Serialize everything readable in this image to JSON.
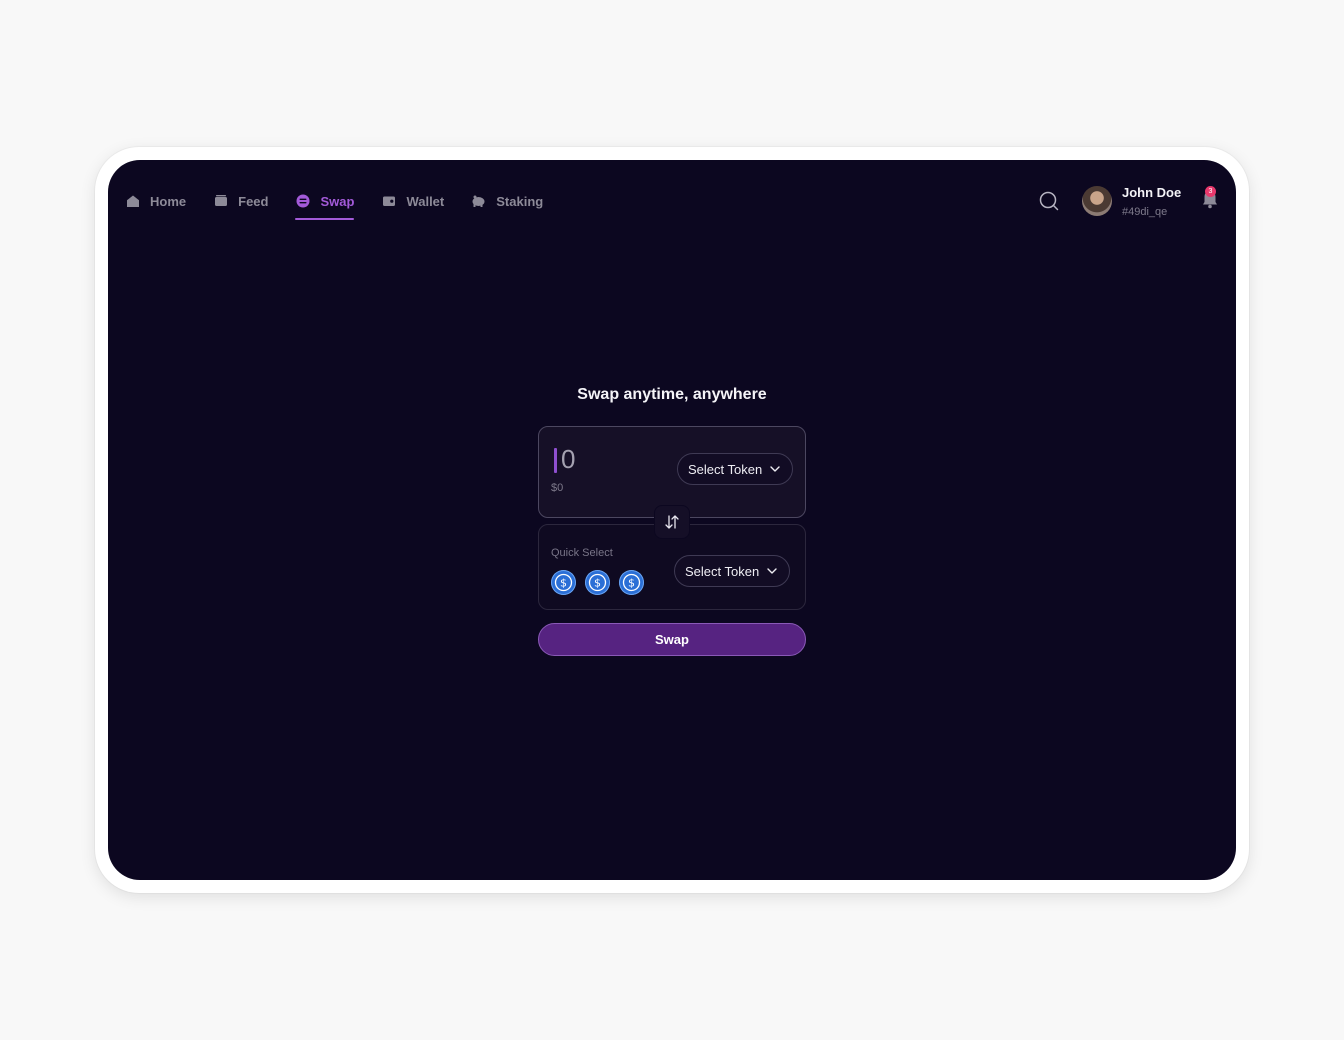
{
  "nav": {
    "items": [
      {
        "label": "Home",
        "icon": "home-icon",
        "active": false
      },
      {
        "label": "Feed",
        "icon": "feed-icon",
        "active": false
      },
      {
        "label": "Swap",
        "icon": "swap-icon",
        "active": true
      },
      {
        "label": "Wallet",
        "icon": "wallet-icon",
        "active": false
      },
      {
        "label": "Staking",
        "icon": "piggy-bank-icon",
        "active": false
      }
    ]
  },
  "user": {
    "name": "John Doe",
    "handle": "#49di_qe",
    "notifications": "3"
  },
  "swap": {
    "headline": "Swap anytime, anywhere",
    "from_amount": "0",
    "from_usd": "$0",
    "from_token_label": "Select Token",
    "to_token_label": "Select Token",
    "quick_select_label": "Quick Select",
    "quick_tokens": [
      "usdc-icon",
      "usdc-icon",
      "usdc-icon"
    ],
    "swap_button_label": "Swap"
  },
  "colors": {
    "background": "#0c0720",
    "accent": "#a35ad9",
    "button": "#562381",
    "badge": "#e8386c",
    "coin": "#2b6fd6"
  }
}
